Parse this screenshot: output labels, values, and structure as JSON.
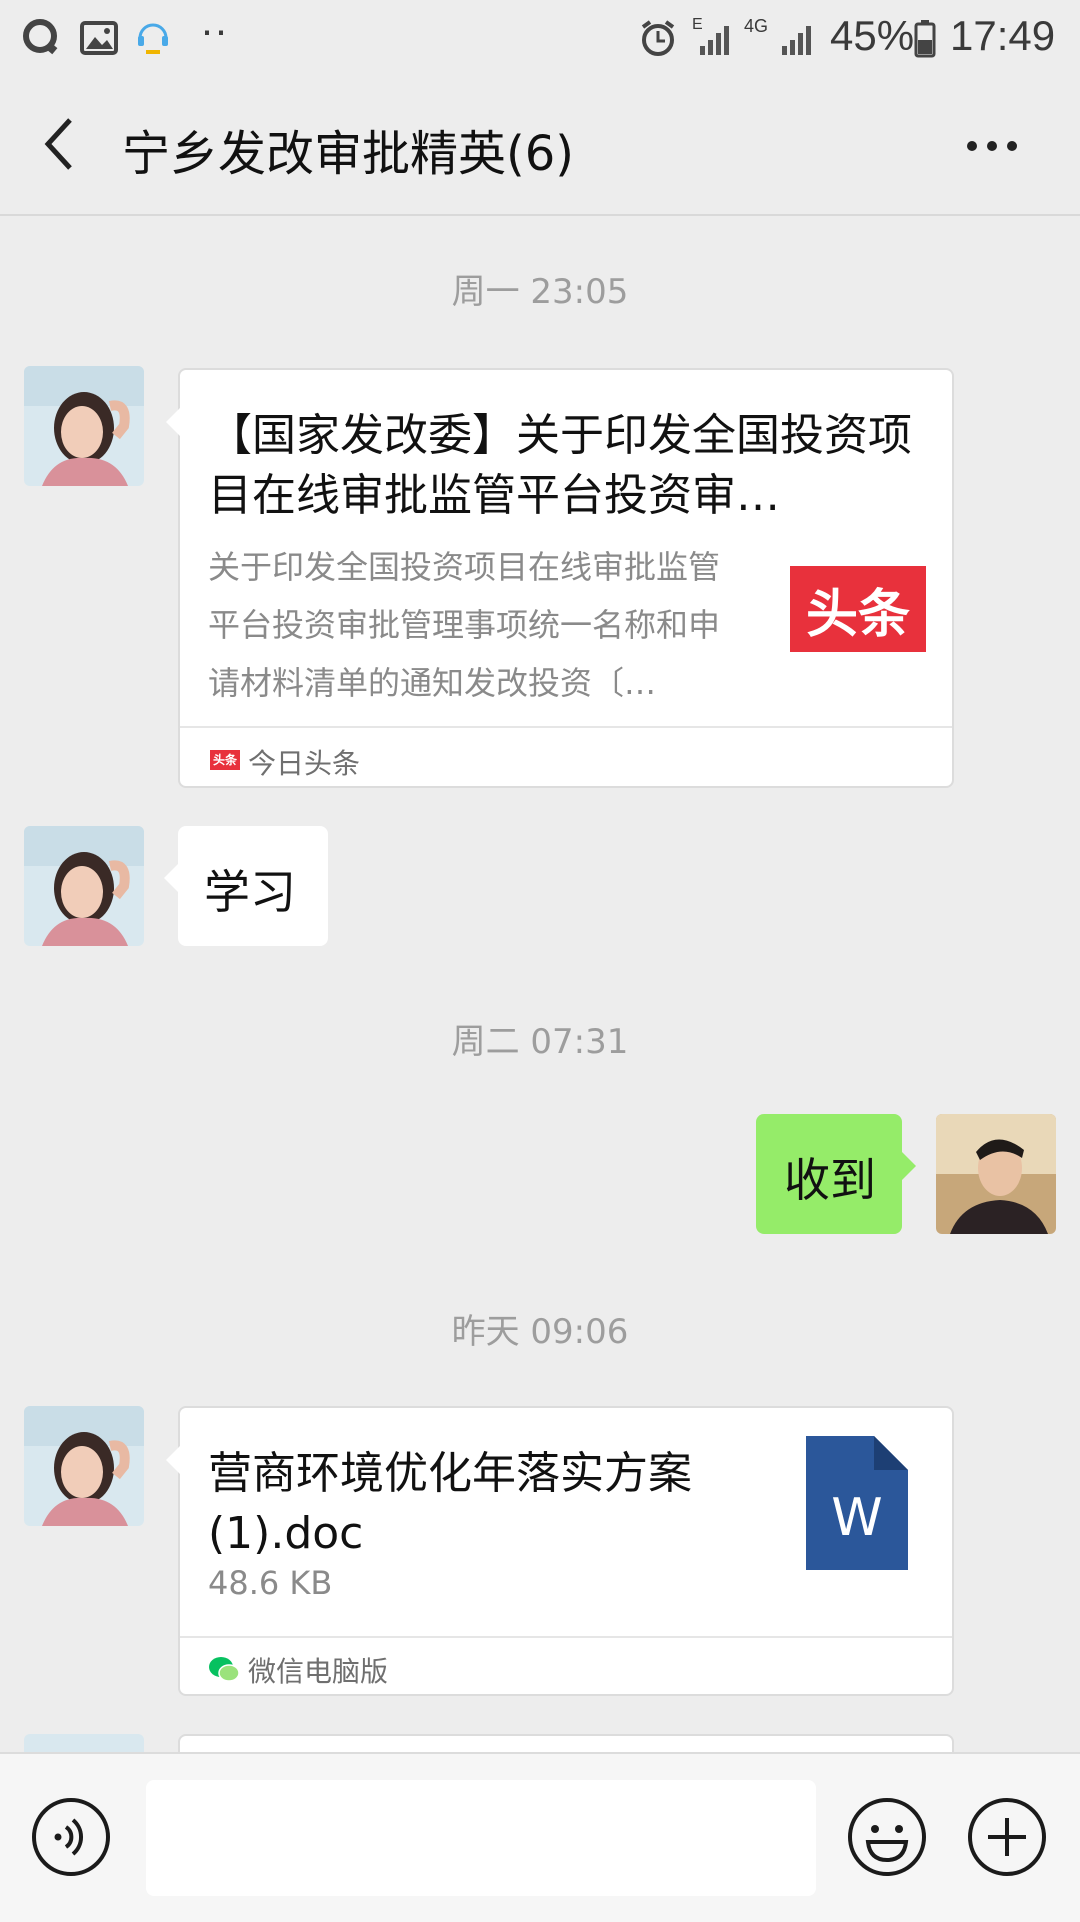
{
  "status_bar": {
    "battery": "45%",
    "time": "17:49",
    "network_4g": "4G",
    "network_e": "E",
    "icons": [
      "qq-icon",
      "gallery-icon",
      "assistant-icon",
      "more-dots-icon",
      "alarm-icon",
      "signal-icon",
      "battery-icon"
    ]
  },
  "header": {
    "title": "宁乡发改审批精英(6)"
  },
  "messages": {
    "ts1": "周一 23:05",
    "link_card": {
      "title": "【国家发改委】关于印发全国投资项目在线审批监管平台投资审…",
      "desc": "关于印发全国投资项目在线审批监管平台投资审批管理事项统一名称和申请材料清单的通知发改投资〔…",
      "thumb_text": "头条",
      "source_badge": "头条",
      "source": "今日头条"
    },
    "text1": "学习",
    "ts2": "周二 07:31",
    "reply": "收到",
    "ts3": "昨天 09:06",
    "file_card": {
      "name": "营商环境优化年落实方案(1).doc",
      "size": "48.6 KB",
      "icon_letter": "W",
      "source": "微信电脑版"
    }
  },
  "colors": {
    "background": "#ededed",
    "sent_bubble": "#95ec69",
    "toutiao_red": "#e8313c",
    "word_blue": "#2b579a",
    "wechat_green": "#07c160"
  },
  "input_bar": {
    "icons": [
      "voice-icon",
      "emoji-icon",
      "plus-icon"
    ]
  }
}
